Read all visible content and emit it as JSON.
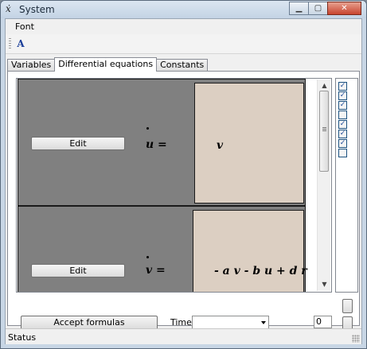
{
  "window": {
    "title": "System",
    "icon": "x-dot-icon",
    "caption_buttons": [
      "minimize",
      "maximize",
      "close"
    ]
  },
  "menu": {
    "items": [
      {
        "label": "Font"
      }
    ]
  },
  "toolbar": {
    "buttons": [
      {
        "icon": "font-icon"
      }
    ]
  },
  "tabs": [
    {
      "label": "Variables",
      "active": false
    },
    {
      "label": "Differential equations",
      "active": true
    },
    {
      "label": "Constants",
      "active": false
    }
  ],
  "equations": [
    {
      "edit_label": "Edit",
      "lhs": "u =",
      "rhs": "v"
    },
    {
      "edit_label": "Edit",
      "lhs": "v =",
      "rhs": "- a v - b u + d r"
    }
  ],
  "checkboxes": [
    true,
    true,
    true,
    false,
    true,
    true,
    true,
    false
  ],
  "controls": {
    "accept_label": "Accept formulas",
    "time_label": "Time",
    "time_selected": "",
    "numeric_value": "0"
  },
  "status": {
    "text": "Status"
  },
  "colors": {
    "equation_background": "#808080",
    "formula_panel": "#dccfc2",
    "titlebar": "#c8d6e5",
    "close_button": "#c8452f"
  }
}
